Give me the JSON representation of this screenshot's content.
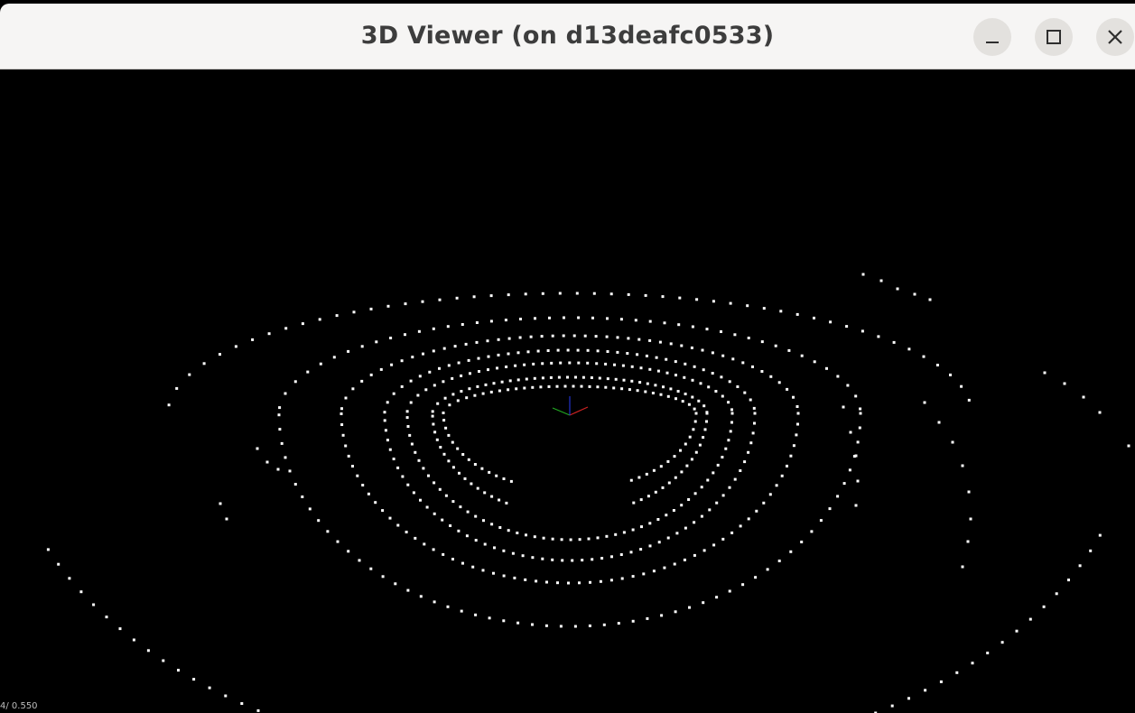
{
  "window": {
    "title": "3D Viewer (on d13deafc0533)",
    "buttons": {
      "minimize": "minimize-icon",
      "maximize": "maximize-icon",
      "close": "close-icon"
    }
  },
  "viewer": {
    "background": "#000000",
    "point_color": "#ffffff",
    "axis_colors": {
      "x": "#cc2222",
      "y": "#22aa22",
      "z": "#2233cc"
    },
    "status_text": "4/ 0.550"
  }
}
